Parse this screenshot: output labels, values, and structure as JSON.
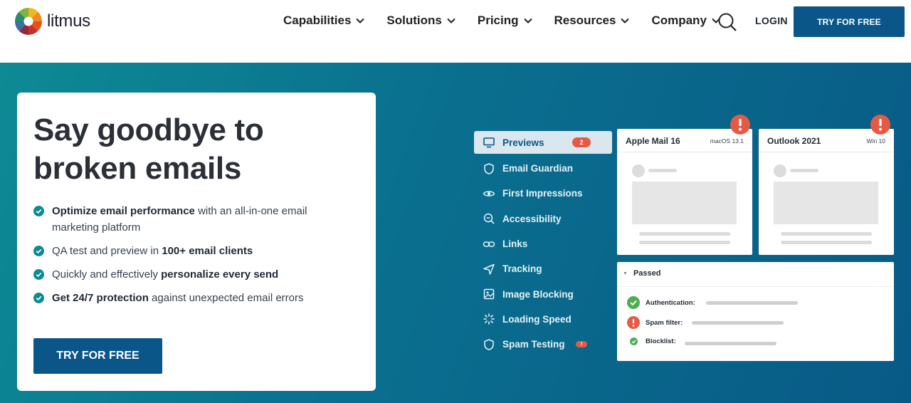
{
  "brand": {
    "name": "litmus"
  },
  "nav": {
    "items": [
      {
        "label": "Capabilities"
      },
      {
        "label": "Solutions"
      },
      {
        "label": "Pricing"
      },
      {
        "label": "Resources"
      },
      {
        "label": "Company"
      }
    ],
    "login": "LOGIN",
    "cta": "TRY FOR FREE",
    "search_icon": "search-icon"
  },
  "hero": {
    "title": "Say goodbye to broken emails",
    "bullets": [
      {
        "strong": "Optimize email performance",
        "text": " with an all-in-one email marketing platform",
        "lead": ""
      },
      {
        "lead": "QA test and preview in ",
        "strong": "100+ email clients",
        "text": ""
      },
      {
        "lead": "Quickly and effectively ",
        "strong": "personalize every send",
        "text": ""
      },
      {
        "strong": "Get 24/7 protection",
        "text": " against unexpected email errors",
        "lead": ""
      }
    ],
    "cta": "TRY FOR FREE"
  },
  "illustration": {
    "features": [
      {
        "label": "Previews",
        "icon": "monitor-icon",
        "badge": "2",
        "active": true
      },
      {
        "label": "Email Guardian",
        "icon": "shield-icon"
      },
      {
        "label": "First Impressions",
        "icon": "eye-icon"
      },
      {
        "label": "Accessibility",
        "icon": "zoom-icon"
      },
      {
        "label": "Links",
        "icon": "link-icon"
      },
      {
        "label": "Tracking",
        "icon": "send-icon"
      },
      {
        "label": "Image Blocking",
        "icon": "image-icon"
      },
      {
        "label": "Loading Speed",
        "icon": "loader-icon"
      },
      {
        "label": "Spam Testing",
        "icon": "shield-icon",
        "badge": "!"
      }
    ],
    "previews": [
      {
        "client": "Apple Mail 16",
        "os": "macOS 13.1"
      },
      {
        "client": "Outlook 2021",
        "os": "Win 10"
      }
    ],
    "results": {
      "title": "Passed",
      "rows": [
        {
          "label": "Authentication:",
          "status": "pass"
        },
        {
          "label": "Spam filter:",
          "status": "fail"
        },
        {
          "label": "Blocklist:",
          "status": "pass"
        }
      ]
    },
    "colors": {
      "accent": "#0b5688",
      "alert": "#e55a45",
      "pass": "#4caf50",
      "teal": "#0d8a94"
    }
  }
}
